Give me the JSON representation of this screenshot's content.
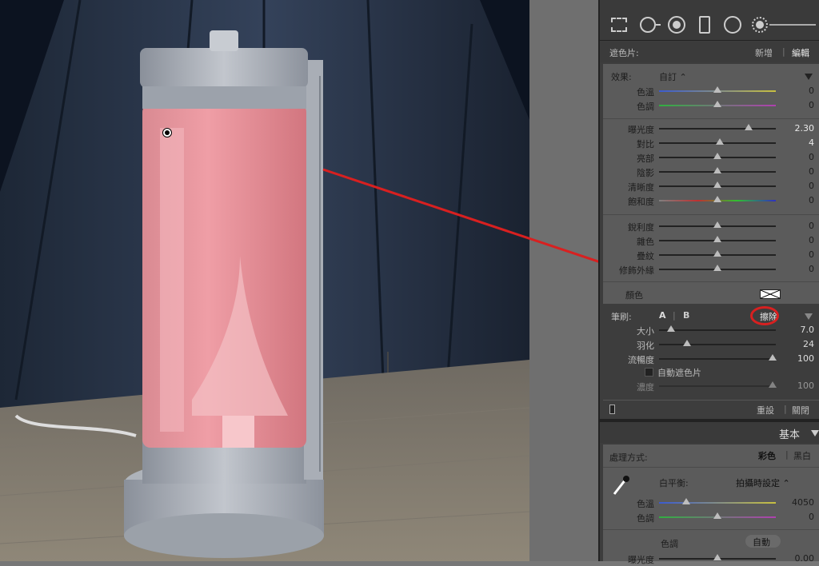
{
  "tools": {
    "items": [
      "crop-overlay-icon",
      "spot-removal-icon",
      "red-eye-icon",
      "graduated-filter-icon",
      "radial-filter-icon",
      "adjustment-brush-icon"
    ]
  },
  "mask": {
    "label": "遮色片:",
    "new_label": "新增",
    "sep": "|",
    "edit_label": "編輯"
  },
  "effect": {
    "label": "效果:",
    "preset": "自訂 ⌃",
    "sliders_group1": [
      {
        "name": "色溫",
        "value": "0",
        "pos": 0.5
      },
      {
        "name": "色調",
        "value": "0",
        "pos": 0.5
      }
    ],
    "sliders_group2": [
      {
        "name": "曝光度",
        "value": "2.30",
        "pos": 0.77
      },
      {
        "name": "對比",
        "value": "4",
        "pos": 0.52
      },
      {
        "name": "亮部",
        "value": "0",
        "pos": 0.5
      },
      {
        "name": "陰影",
        "value": "0",
        "pos": 0.5
      },
      {
        "name": "清晰度",
        "value": "0",
        "pos": 0.5
      },
      {
        "name": "飽和度",
        "value": "0",
        "pos": 0.5
      }
    ],
    "sliders_group3": [
      {
        "name": "銳利度",
        "value": "0",
        "pos": 0.5
      },
      {
        "name": "雜色",
        "value": "0",
        "pos": 0.5
      },
      {
        "name": "疊紋",
        "value": "0",
        "pos": 0.5
      },
      {
        "name": "修飾外緣",
        "value": "0",
        "pos": 0.5
      }
    ],
    "color_label": "顏色"
  },
  "brush": {
    "label": "筆刷:",
    "a": "A",
    "sep": "|",
    "b": "B",
    "erase": "擦除",
    "sliders": [
      {
        "name": "大小",
        "value": "7.0",
        "pos": 0.1
      },
      {
        "name": "羽化",
        "value": "24",
        "pos": 0.24
      },
      {
        "name": "流暢度",
        "value": "100",
        "pos": 0.97
      }
    ],
    "auto_mask": "自動遮色片",
    "density": {
      "name": "濃度",
      "value": "100",
      "pos": 0.97
    }
  },
  "footer": {
    "reset": "重設",
    "sep": "|",
    "close": "關閉"
  },
  "basic": {
    "title": "基本",
    "treatment_label": "處理方式:",
    "color": "彩色",
    "sep": "|",
    "bw": "黑白",
    "wb_label": "白平衡:",
    "wb_value": "拍攝時設定 ⌃",
    "sliders": [
      {
        "name": "色溫",
        "value": "4050",
        "pos": 0.23
      },
      {
        "name": "色調",
        "value": "0",
        "pos": 0.5
      }
    ],
    "tone_label": "色調",
    "auto": "自動",
    "exposure": {
      "name": "曝光度",
      "value": "0.00",
      "pos": 0.5
    }
  },
  "colors": {
    "accent_red": "#d82020",
    "panel_bg": "#5b5b5b"
  }
}
